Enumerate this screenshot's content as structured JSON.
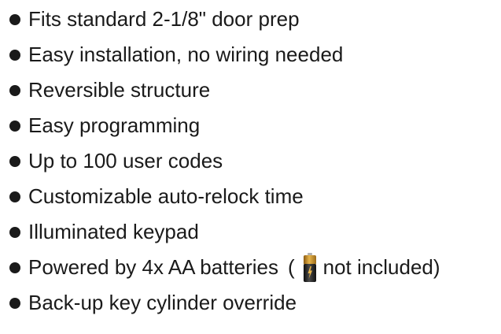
{
  "features": [
    "Fits standard 2-1/8\" door prep",
    "Easy installation, no wiring needed",
    "Reversible structure",
    "Easy programming",
    "Up to 100 user codes",
    "Customizable auto-relock time",
    "Illuminated keypad",
    "Powered by 4x AA batteries",
    "Back-up key cylinder override"
  ],
  "battery_note": {
    "open_paren": "(",
    "text": "not included)",
    "icon": "battery-icon"
  },
  "colors": {
    "text": "#1a1a1a",
    "battery_gold": "#c8922a",
    "battery_black": "#1f1f1f"
  }
}
